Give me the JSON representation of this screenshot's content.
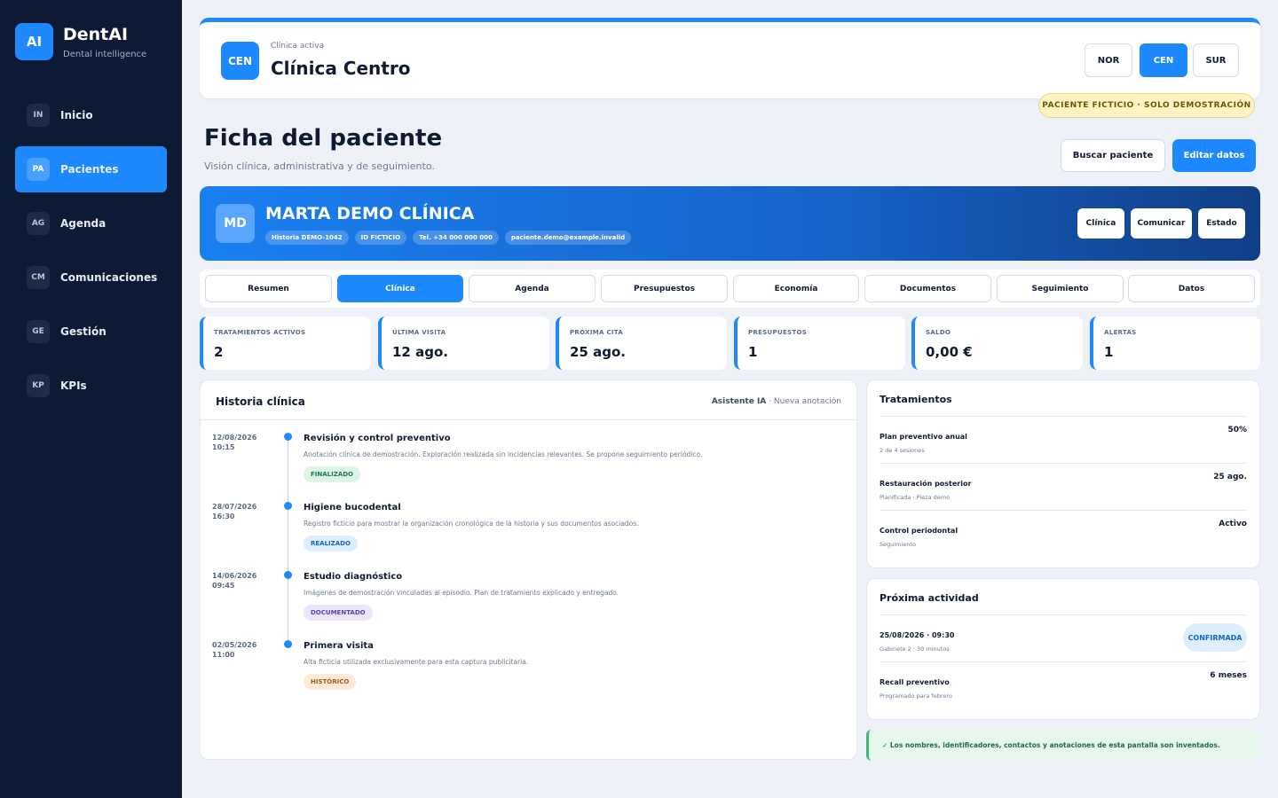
{
  "brand": {
    "logo": "AI",
    "name": "DentAI",
    "subtitle": "Dental intelligence"
  },
  "sidebar": {
    "items": [
      {
        "abbr": "IN",
        "label": "Inicio"
      },
      {
        "abbr": "PA",
        "label": "Pacientes"
      },
      {
        "abbr": "AG",
        "label": "Agenda"
      },
      {
        "abbr": "CM",
        "label": "Comunicaciones"
      },
      {
        "abbr": "GE",
        "label": "Gestión"
      },
      {
        "abbr": "KP",
        "label": "KPIs"
      }
    ]
  },
  "clinic": {
    "badge": "CEN",
    "label": "Clínica activa",
    "name": "Clínica Centro",
    "options": [
      "NOR",
      "CEN",
      "SUR"
    ]
  },
  "demo_badge": "PACIENTE FICTICIO · SOLO DEMOSTRACIÓN",
  "header": {
    "title": "Ficha del paciente",
    "subtitle": "Visión clínica, administrativa y de seguimiento.",
    "search_label": "Buscar paciente",
    "edit_label": "Editar datos"
  },
  "patient": {
    "initials": "MD",
    "name": "MARTA DEMO CLÍNICA",
    "chips": [
      "Historia DEMO-1042",
      "ID FICTICIO",
      "Tel. +34 000 000 000",
      "paciente.demo@example.invalid"
    ],
    "actions": [
      "Clínica",
      "Comunicar",
      "Estado"
    ]
  },
  "tabs": [
    "Resumen",
    "Clínica",
    "Agenda",
    "Presupuestos",
    "Economía",
    "Documentos",
    "Seguimiento",
    "Datos"
  ],
  "kpis": [
    {
      "label": "TRATAMIENTOS ACTIVOS",
      "value": "2"
    },
    {
      "label": "ÚLTIMA VISITA",
      "value": "12 ago."
    },
    {
      "label": "PRÓXIMA CITA",
      "value": "25 ago."
    },
    {
      "label": "PRESUPUESTOS",
      "value": "1"
    },
    {
      "label": "SALDO",
      "value": "0,00 €"
    },
    {
      "label": "ALERTAS",
      "value": "1"
    }
  ],
  "history": {
    "title": "Historia clínica",
    "assistant": "Asistente IA",
    "separator": "·",
    "new_note": "Nueva anotación",
    "entries": [
      {
        "date": "12/08/2026",
        "time": "10:15",
        "title": "Revisión y control preventivo",
        "desc": "Anotación clínica de demostración. Exploración realizada sin incidencias relevantes. Se propone seguimiento periódico.",
        "tag": "FINALIZADO",
        "tag_bg": "#dcf5e6",
        "tag_color": "#1f7a48"
      },
      {
        "date": "28/07/2026",
        "time": "16:30",
        "title": "Higiene bucodental",
        "desc": "Registro ficticio para mostrar la organización cronológica de la historia y sus documentos asociados.",
        "tag": "REALIZADO",
        "tag_bg": "#ddeeff",
        "tag_color": "#1566c2"
      },
      {
        "date": "14/06/2026",
        "time": "09:45",
        "title": "Estudio diagnóstico",
        "desc": "Imágenes de demostración vinculadas al episodio. Plan de tratamiento explicado y entregado.",
        "tag": "DOCUMENTADO",
        "tag_bg": "#ece6fb",
        "tag_color": "#5b3fb5"
      },
      {
        "date": "02/05/2026",
        "time": "11:00",
        "title": "Primera visita",
        "desc": "Alta ficticia utilizada exclusivamente para esta captura publicitaria.",
        "tag": "HISTÓRICO",
        "tag_bg": "#fdebd6",
        "tag_color": "#a85a12"
      }
    ]
  },
  "treatments": {
    "title": "Tratamientos",
    "rows": [
      {
        "title": "Plan preventivo anual",
        "sub": "2 de 4 sesiones",
        "value": "50%"
      },
      {
        "title": "Restauración posterior",
        "sub": "Planificada · Pieza demo",
        "value": "25 ago."
      },
      {
        "title": "Control periodontal",
        "sub": "Seguimiento",
        "value": "Activo"
      }
    ]
  },
  "activity": {
    "title": "Próxima actividad",
    "rows": [
      {
        "title": "25/08/2026 · 09:30",
        "sub": "Gabinete 2 · 30 minutos",
        "value": "CONFIRMADA"
      },
      {
        "title": "Recall preventivo",
        "sub": "Programado para febrero",
        "value": "6 meses"
      }
    ]
  },
  "notice": "✓ Los nombres, identificadores, contactos y anotaciones de esta pantalla son inventados.",
  "colors": {
    "accent": "#1e88ff",
    "sidebar": "#0c1a33",
    "background": "#eef2f8"
  }
}
